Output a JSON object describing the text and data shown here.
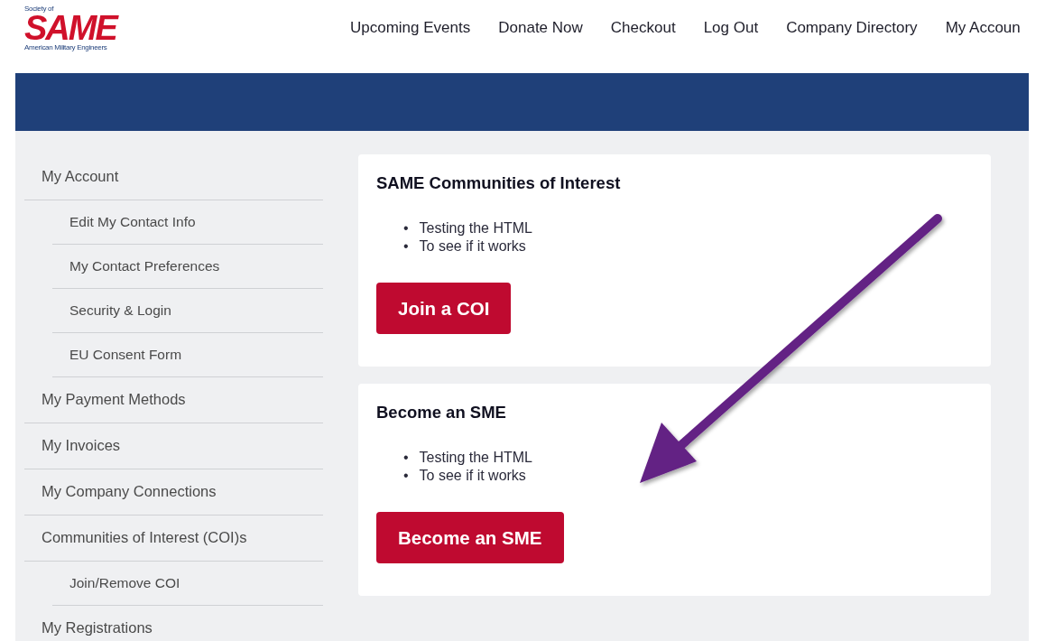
{
  "logo": {
    "top_line": "Society of",
    "wordmark": "SAME",
    "bottom_line": "American Military Engineers"
  },
  "nav": [
    {
      "label": "Upcoming Events"
    },
    {
      "label": "Donate Now"
    },
    {
      "label": "Checkout"
    },
    {
      "label": "Log Out"
    },
    {
      "label": "Company Directory"
    },
    {
      "label": "My Accoun"
    }
  ],
  "sidebar": {
    "items": [
      {
        "label": "My Account",
        "children": [
          {
            "label": "Edit My Contact Info"
          },
          {
            "label": "My Contact Preferences"
          },
          {
            "label": "Security & Login"
          },
          {
            "label": "EU Consent Form"
          }
        ]
      },
      {
        "label": "My Payment Methods"
      },
      {
        "label": "My Invoices"
      },
      {
        "label": "My Company Connections"
      },
      {
        "label": "Communities of Interest (COI)s",
        "children": [
          {
            "label": "Join/Remove COI"
          }
        ]
      },
      {
        "label": "My Registrations"
      }
    ]
  },
  "cards": [
    {
      "title": "SAME Communities of Interest",
      "bullets": [
        {
          "marker": "•",
          "text": "Testing the HTML"
        },
        {
          "marker": "•",
          "text": "To see if it works"
        }
      ],
      "button": "Join a COI"
    },
    {
      "title": "Become an SME",
      "bullets": [
        {
          "marker": "•",
          "text": "Testing the HTML"
        },
        {
          "marker": "•",
          "text": "To see if it works"
        }
      ],
      "button": "Become an SME"
    }
  ]
}
